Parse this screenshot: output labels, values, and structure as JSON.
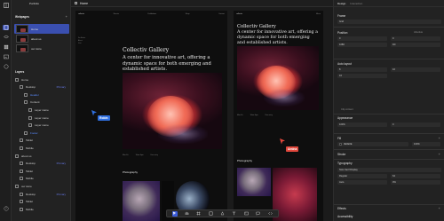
{
  "sidebar": {
    "project_name": "Portfolio",
    "webpages_title": "Webpages",
    "pages": [
      {
        "label": "Home",
        "active": true
      },
      {
        "label": "about us",
        "active": false
      },
      {
        "label": "our store",
        "active": false
      }
    ],
    "layers_title": "Layers",
    "layers": [
      {
        "label": "Home",
        "indent": 0,
        "badge": ""
      },
      {
        "label": "Desktop",
        "indent": 1,
        "badge": "Primary"
      },
      {
        "label": "Header",
        "indent": 2,
        "badge": "",
        "highlight": true
      },
      {
        "label": "Content",
        "indent": 2,
        "badge": ""
      },
      {
        "label": "Layer name",
        "indent": 3,
        "badge": ""
      },
      {
        "label": "Layer name",
        "indent": 3,
        "badge": ""
      },
      {
        "label": "Layer name",
        "indent": 3,
        "badge": ""
      },
      {
        "label": "Footer",
        "indent": 2,
        "badge": "",
        "highlight": true
      },
      {
        "label": "Tablet",
        "indent": 1,
        "badge": ""
      },
      {
        "label": "Mobile",
        "indent": 1,
        "badge": ""
      },
      {
        "label": "about us",
        "indent": 0,
        "badge": ""
      },
      {
        "label": "Desktop",
        "indent": 1,
        "badge": "Primary"
      },
      {
        "label": "Tablet",
        "indent": 1,
        "badge": ""
      },
      {
        "label": "Mobile",
        "indent": 1,
        "badge": ""
      },
      {
        "label": "our store",
        "indent": 0,
        "badge": ""
      },
      {
        "label": "Desktop",
        "indent": 1,
        "badge": "Primary"
      },
      {
        "label": "Tablet",
        "indent": 1,
        "badge": ""
      },
      {
        "label": "Mobile",
        "indent": 1,
        "badge": ""
      }
    ]
  },
  "header": {
    "title": "Home"
  },
  "frames": {
    "desktop": {
      "name": "collectiv",
      "nav_items": [
        "Events",
        "Exhibitions",
        "Shop",
        "Contact"
      ],
      "side_links": [
        "For Artists",
        "About",
        "Visit"
      ],
      "title": "Collectiv Gallery",
      "description": "A center for innovative art, offering a dynamic space for both emerging and established artists.",
      "meta": [
        "Mon–Fri",
        "10am–6pm",
        "Free entry"
      ],
      "photography": "Photography"
    },
    "tablet": {
      "name": "collectiv",
      "nav_items": [
        "Menu"
      ],
      "title": "Collectiv Gallery",
      "description": "A center for innovative art, offering a dynamic space for both emerging and established artists.",
      "meta": [
        "Mon–Fri",
        "10am–6pm",
        "Free entry"
      ],
      "photography": "Photography"
    },
    "mobile": {
      "name": "collectiv",
      "nav_items": [
        "Menu"
      ],
      "title": "Collectiv Gallery",
      "description": "A center for innovative art, offering a dynamic space for both emerging and established artists.",
      "photography": "Photography"
    }
  },
  "cursors": [
    {
      "name": "Robin",
      "color": "#2f6fe0"
    },
    {
      "name": "Amina",
      "color": "#e2483d"
    }
  ],
  "inspector": {
    "tabs": [
      "Design",
      "Interaction"
    ],
    "frame_title": "Frame",
    "frame_value": "Grid",
    "position_title": "Position",
    "position_value": "Absolute",
    "x_value": "0",
    "y_value": "0",
    "w_value": "1080",
    "h_value": "Fill",
    "auto_layout_title": "Auto layout",
    "gap_value": "8",
    "pad_value": "16",
    "clip_label": "Clip content",
    "appearance_title": "Appearance",
    "opacity_value": "100%",
    "radius_value": "0",
    "fill_title": "Fill",
    "fill_value": "0E0E0E",
    "fill_pct": "100%",
    "stroke_title": "Stroke",
    "typography_title": "Typography",
    "font_value": "Noto Serif Display",
    "weight_value": "Regular",
    "size_value": "64",
    "lh_value": "Auto",
    "ls_value": "0%",
    "effects_title": "Effects",
    "accessibility_title": "Accessibility"
  }
}
